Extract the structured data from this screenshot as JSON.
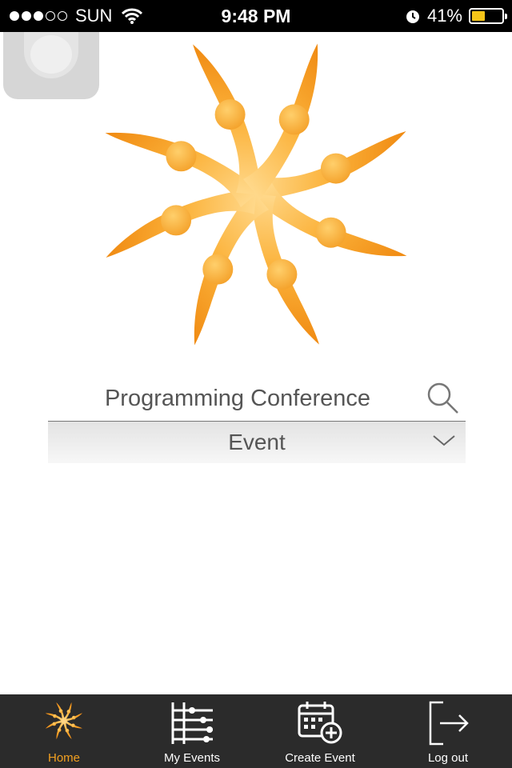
{
  "status_bar": {
    "carrier": "SUN",
    "time": "9:48 PM",
    "battery": "41%",
    "battery_level": 0.41,
    "signal_bars": 3
  },
  "search": {
    "value": "Programming Conference",
    "icon": "search-icon"
  },
  "event_dropdown": {
    "selected": "Event",
    "icon": "chevron-down-icon"
  },
  "tabs": [
    {
      "label": "Home",
      "icon": "sun-logo-icon",
      "active": true
    },
    {
      "label": "My Events",
      "icon": "sliders-icon",
      "active": false
    },
    {
      "label": "Create Event",
      "icon": "calendar-add-icon",
      "active": false
    },
    {
      "label": "Log out",
      "icon": "logout-icon",
      "active": false
    }
  ],
  "colors": {
    "accent": "#f3a020",
    "tabbar": "#2b2b2b",
    "statusbar": "#000000"
  }
}
